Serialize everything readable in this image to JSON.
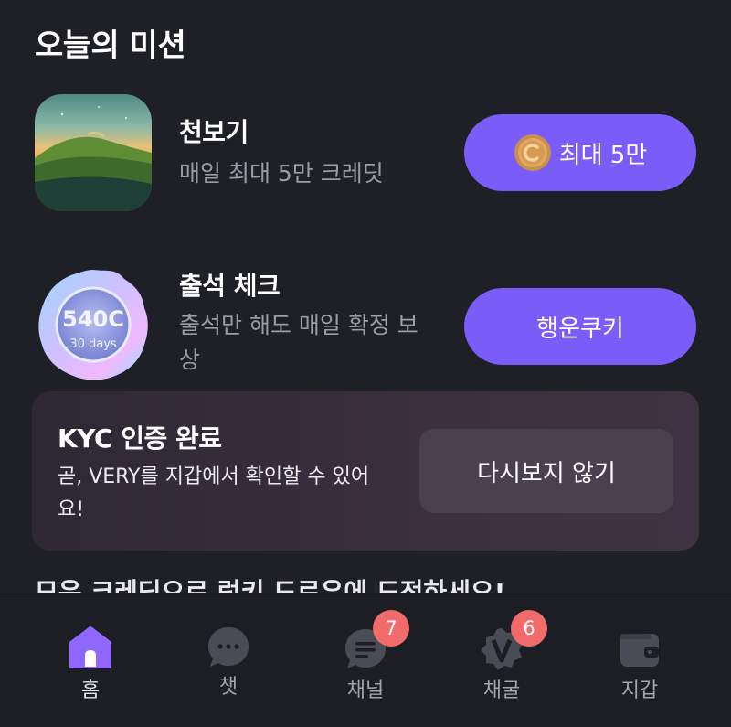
{
  "page": {
    "title": "오늘의 미션"
  },
  "missions": [
    {
      "title": "천보기",
      "subtitle": "매일 최대 5만 크레딧",
      "button_label": "최대 5만",
      "button_icon": "coin-icon"
    },
    {
      "title": "출석 체크",
      "subtitle": "출석만 해도 매일 확정 보상",
      "badge_value": "540C",
      "badge_caption": "30 days",
      "button_label": "행운쿠키"
    }
  ],
  "kyc": {
    "title": "KYC 인증 완료",
    "description": "곧, VERY를 지갑에서 확인할 수 있어요!",
    "dismiss_label": "다시보지 않기"
  },
  "cut_off_text": "모은 크레딧으로 럭키 드로우에 도전하세요!",
  "nav": {
    "items": [
      {
        "label": "홈",
        "icon": "home-icon",
        "active": true
      },
      {
        "label": "챗",
        "icon": "chat-icon"
      },
      {
        "label": "채널",
        "icon": "channel-icon",
        "badge": "7"
      },
      {
        "label": "채굴",
        "icon": "mining-icon",
        "badge": "6"
      },
      {
        "label": "지갑",
        "icon": "wallet-icon"
      }
    ]
  },
  "colors": {
    "background": "#1f2026",
    "accent": "#7a5cf8",
    "badge": "#f26b6b",
    "muted_text": "#9c9ca6"
  }
}
